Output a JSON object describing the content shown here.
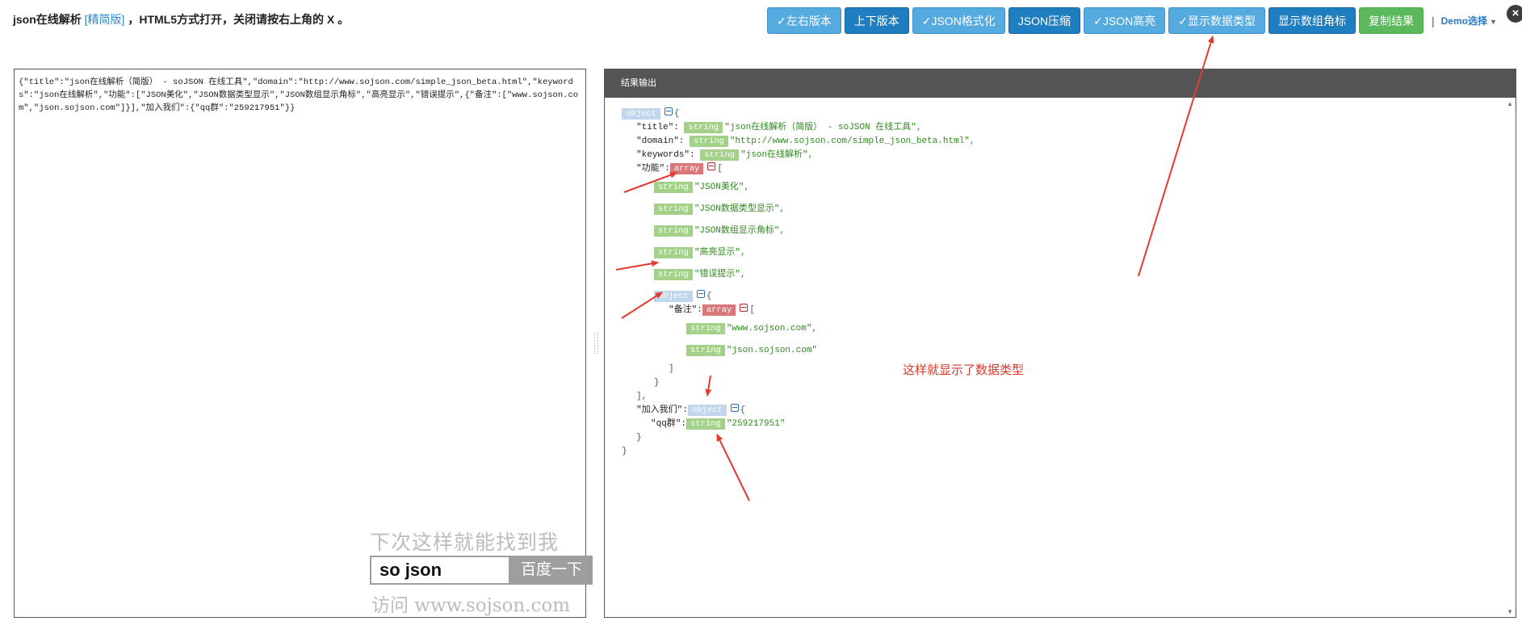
{
  "header": {
    "title_prefix": "json在线解析",
    "title_edition": "[精简版]",
    "title_suffix": "，HTML5方式打开，关闭请按右上角的 X 。"
  },
  "toolbar": {
    "buttons": [
      {
        "label": "✓左右版本"
      },
      {
        "label": "上下版本"
      },
      {
        "label": "✓JSON格式化"
      },
      {
        "label": "JSON压缩"
      },
      {
        "label": "✓JSON高亮"
      },
      {
        "label": "✓显示数据类型"
      },
      {
        "label": "显示数组角标"
      },
      {
        "label": "复制结果"
      }
    ],
    "separator": "|",
    "demo_label": "Demo选择"
  },
  "close_label": "×",
  "editor": {
    "content": "{\"title\":\"json在线解析（简版） - soJSON 在线工具\",\"domain\":\"http://www.sojson.com/simple_json_beta.html\",\"keywords\":\"json在线解析\",\"功能\":[\"JSON美化\",\"JSON数据类型显示\",\"JSON数组显示角标\",\"高亮显示\",\"错误提示\",{\"备注\":[\"www.sojson.com\",\"json.sojson.com\"]}],\"加入我们\":{\"qq群\":\"259217951\"}}"
  },
  "ad": {
    "top": "下次这样就能找到我",
    "input": "so json",
    "button": "百度一下",
    "bottom": "访问 www.sojson.com"
  },
  "result": {
    "header": "结果输出",
    "annotation": "这样就显示了数据类型",
    "types": {
      "object": "object",
      "string": "string",
      "array": "array"
    },
    "keys": {
      "title": "\"title\":",
      "domain": "\"domain\":",
      "keywords": "\"keywords\":",
      "gongneng": "\"功能\":",
      "beizhu": "\"备注\":",
      "jiaru": "\"加入我们\":",
      "qq": "\"qq群\":"
    },
    "values": {
      "title": "\"json在线解析（简版） - soJSON 在线工具\",",
      "domain": "\"http://www.sojson.com/simple_json_beta.html\",",
      "keywords": "\"json在线解析\",",
      "f1": "\"JSON美化\",",
      "f2": "\"JSON数据类型显示\",",
      "f3": "\"JSON数组显示角标\",",
      "f4": "\"高亮显示\",",
      "f5": "\"错误提示\",",
      "b1": "\"www.sojson.com\",",
      "b2": "\"json.sojson.com\"",
      "qq": "\"259217951\""
    },
    "punct": {
      "open_obj": "{",
      "close_obj": "}",
      "open_arr": "[",
      "close_arr": "]",
      "close_arr_comma": "],"
    }
  },
  "colors": {
    "primary_button": "#1f7ec0",
    "active_button": "#55aadf",
    "copy_button": "#5cb85c",
    "annotation": "#d93a2a",
    "string_tag": "#a3d18a",
    "array_tag": "#d9777a",
    "object_tag": "#bfd6ec"
  }
}
